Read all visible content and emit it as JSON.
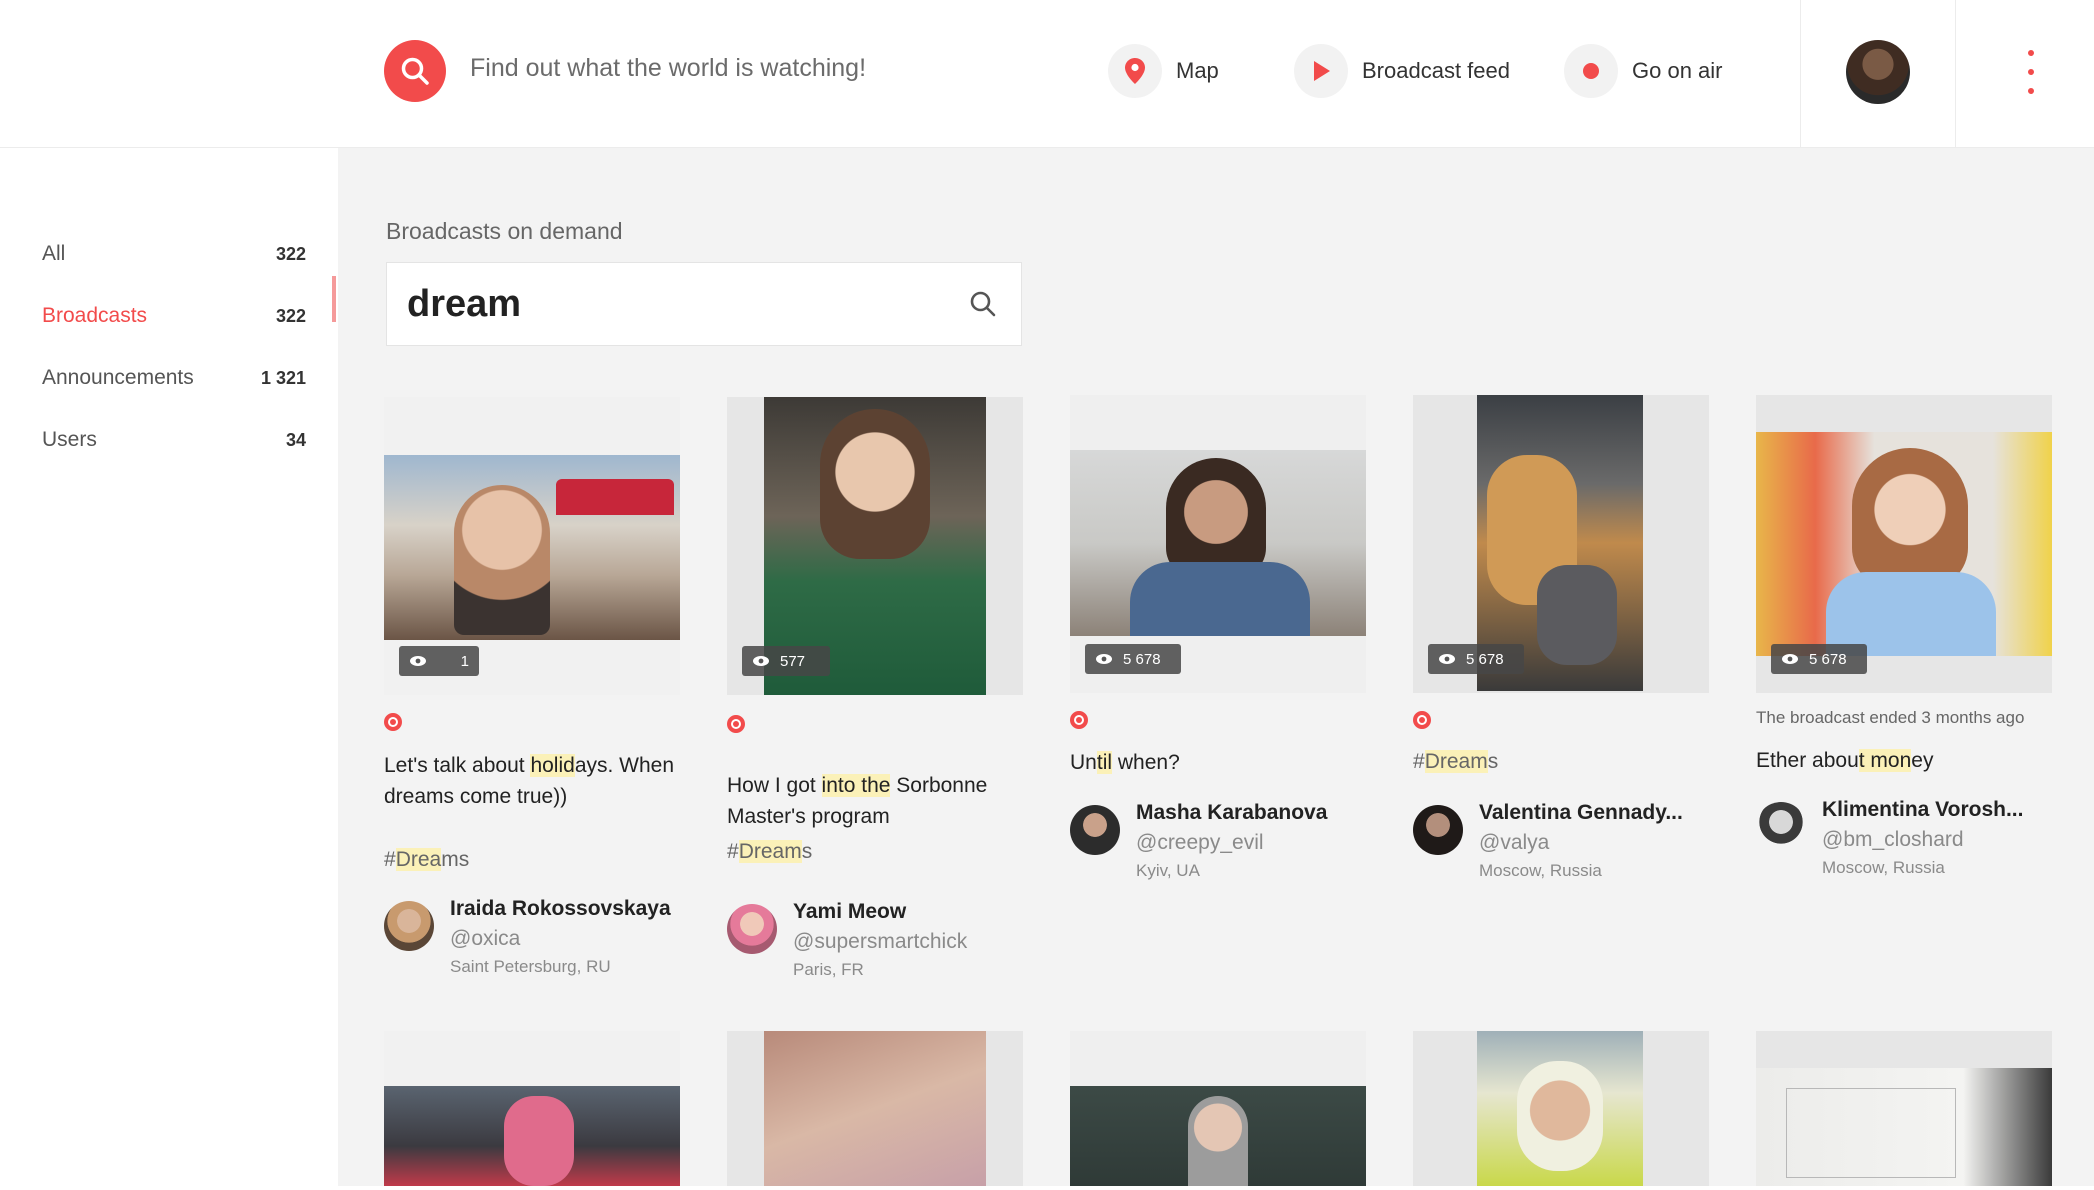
{
  "header": {
    "search_placeholder": "Find out what the world is watching!",
    "nav": [
      {
        "label": "Map",
        "icon": "map-pin-icon"
      },
      {
        "label": "Broadcast feed",
        "icon": "play-icon"
      },
      {
        "label": "Go on air",
        "icon": "record-dot-icon"
      }
    ]
  },
  "sidebar": {
    "items": [
      {
        "label": "All",
        "count": "322"
      },
      {
        "label": "Broadcasts",
        "count": "322"
      },
      {
        "label": "Announcements",
        "count": "1 321"
      },
      {
        "label": "Users",
        "count": "34"
      }
    ]
  },
  "main": {
    "section_title": "Broadcasts on demand",
    "search_value": "dream",
    "cards": [
      {
        "views": "1",
        "title_parts": [
          "Let's talk about ",
          "holid",
          "ays. When dreams come true))"
        ],
        "tag_parts": [
          "#",
          "Drea",
          "ms"
        ],
        "author": {
          "name": "Iraida Rokossovskaya",
          "handle": "@oxica",
          "location": "Saint Petersburg, RU"
        }
      },
      {
        "views": "577",
        "title_parts": [
          "How I got ",
          "into the",
          " Sorbonne Master's program"
        ],
        "tag_parts": [
          "#",
          "Dream",
          "s"
        ],
        "author": {
          "name": "Yami Meow",
          "handle": "@supersmartchick",
          "location": "Paris, FR"
        }
      },
      {
        "views": "5 678",
        "title_parts": [
          "Un",
          "til",
          " when?"
        ],
        "author": {
          "name": "Masha Karabanova",
          "handle": "@creepy_evil",
          "location": "Kyiv, UA"
        }
      },
      {
        "views": "5 678",
        "tag_parts": [
          "#",
          "Dream",
          "s"
        ],
        "author": {
          "name": "Valentina Gennady...",
          "handle": "@valya",
          "location": "Moscow, Russia"
        }
      },
      {
        "views": "5 678",
        "ended_text": "The broadcast ended 3 months ago",
        "title_parts": [
          "Ether abou",
          "t mon",
          "ey"
        ],
        "author": {
          "name": "Klimentina Vorosh...",
          "handle": "@bm_closhard",
          "location": "Moscow, Russia"
        }
      }
    ]
  },
  "colors": {
    "accent": "#f24b4b",
    "highlight": "#fbf1b8"
  }
}
